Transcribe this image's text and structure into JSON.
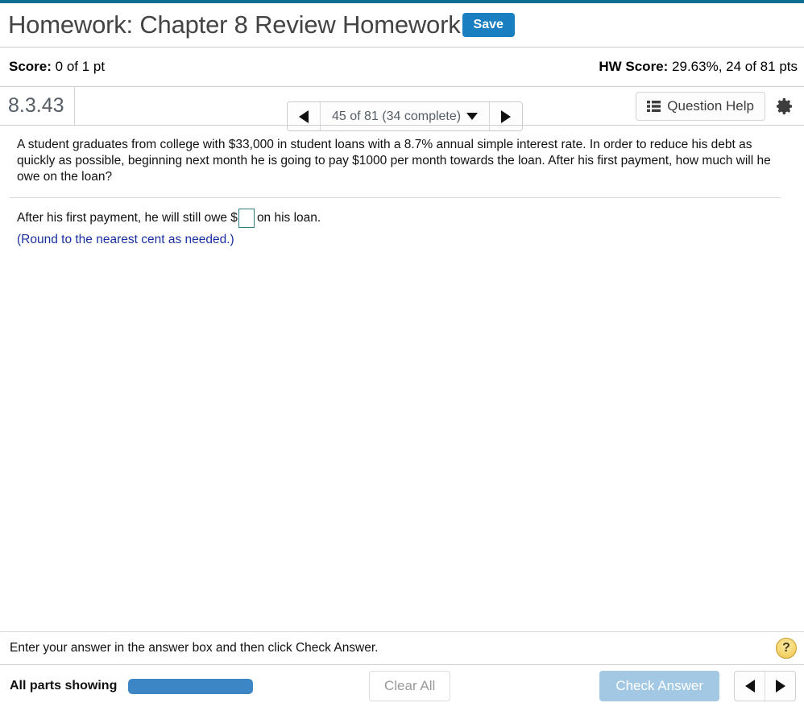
{
  "accent_color": "#0d6e91",
  "header": {
    "title": "Homework: Chapter 8 Review Homework",
    "save_label": "Save"
  },
  "score_bar": {
    "score_label": "Score:",
    "score_value": "0 of 1 pt",
    "nav": {
      "prev_icon": "triangle-left-icon",
      "next_icon": "triangle-right-icon",
      "selector_text": "45 of 81 (34 complete)",
      "caret_icon": "caret-down-icon"
    },
    "hw_score_label": "HW Score:",
    "hw_score_value": "29.63%, 24 of 81 pts"
  },
  "exercise_bar": {
    "exercise_number": "8.3.43",
    "question_help_label": "Question Help",
    "question_help_icon": "list-icon",
    "gear_icon": "gear-icon"
  },
  "question": {
    "text": "A student graduates from college with $33,000 in student loans with a 8.7% annual simple interest rate. In order to reduce his debt as quickly as possible, beginning next month he is going to pay $1000 per month towards the loan. After his first payment, how much will he owe on the loan?",
    "answer_prefix": "After his first payment, he will still owe $",
    "answer_value": "",
    "answer_placeholder": "",
    "answer_suffix": " on his loan.",
    "round_note": "(Round to the nearest cent as needed.)"
  },
  "footer": {
    "hint_text": "Enter your answer in the answer box and then click Check Answer.",
    "help_icon_label": "?",
    "parts_label": "All parts showing",
    "progress_percent": 100,
    "clear_all_label": "Clear All",
    "check_answer_label": "Check Answer",
    "prev_icon": "triangle-left-icon",
    "next_icon": "triangle-right-icon"
  }
}
